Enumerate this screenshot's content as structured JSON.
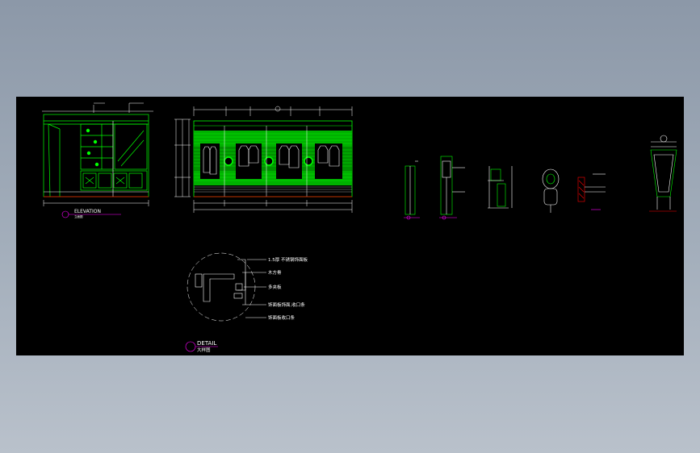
{
  "drawing": {
    "background_color": "#000000",
    "line_colors": {
      "primary": "#00ff00",
      "secondary": "#ffffff",
      "accent": "#ff00ff",
      "section_line": "#ff0000",
      "hatch": "#00c000"
    }
  },
  "elevation_view": {
    "title": "ELEVATION",
    "subtitle": "立面图"
  },
  "detail_view": {
    "title": "DETAIL",
    "subtitle": "大样图",
    "callouts": [
      "1.5厚 不锈钢饰面板",
      "木方骨",
      "多夹板",
      "饰面板饰面,收口条",
      "饰面板收口条"
    ]
  }
}
